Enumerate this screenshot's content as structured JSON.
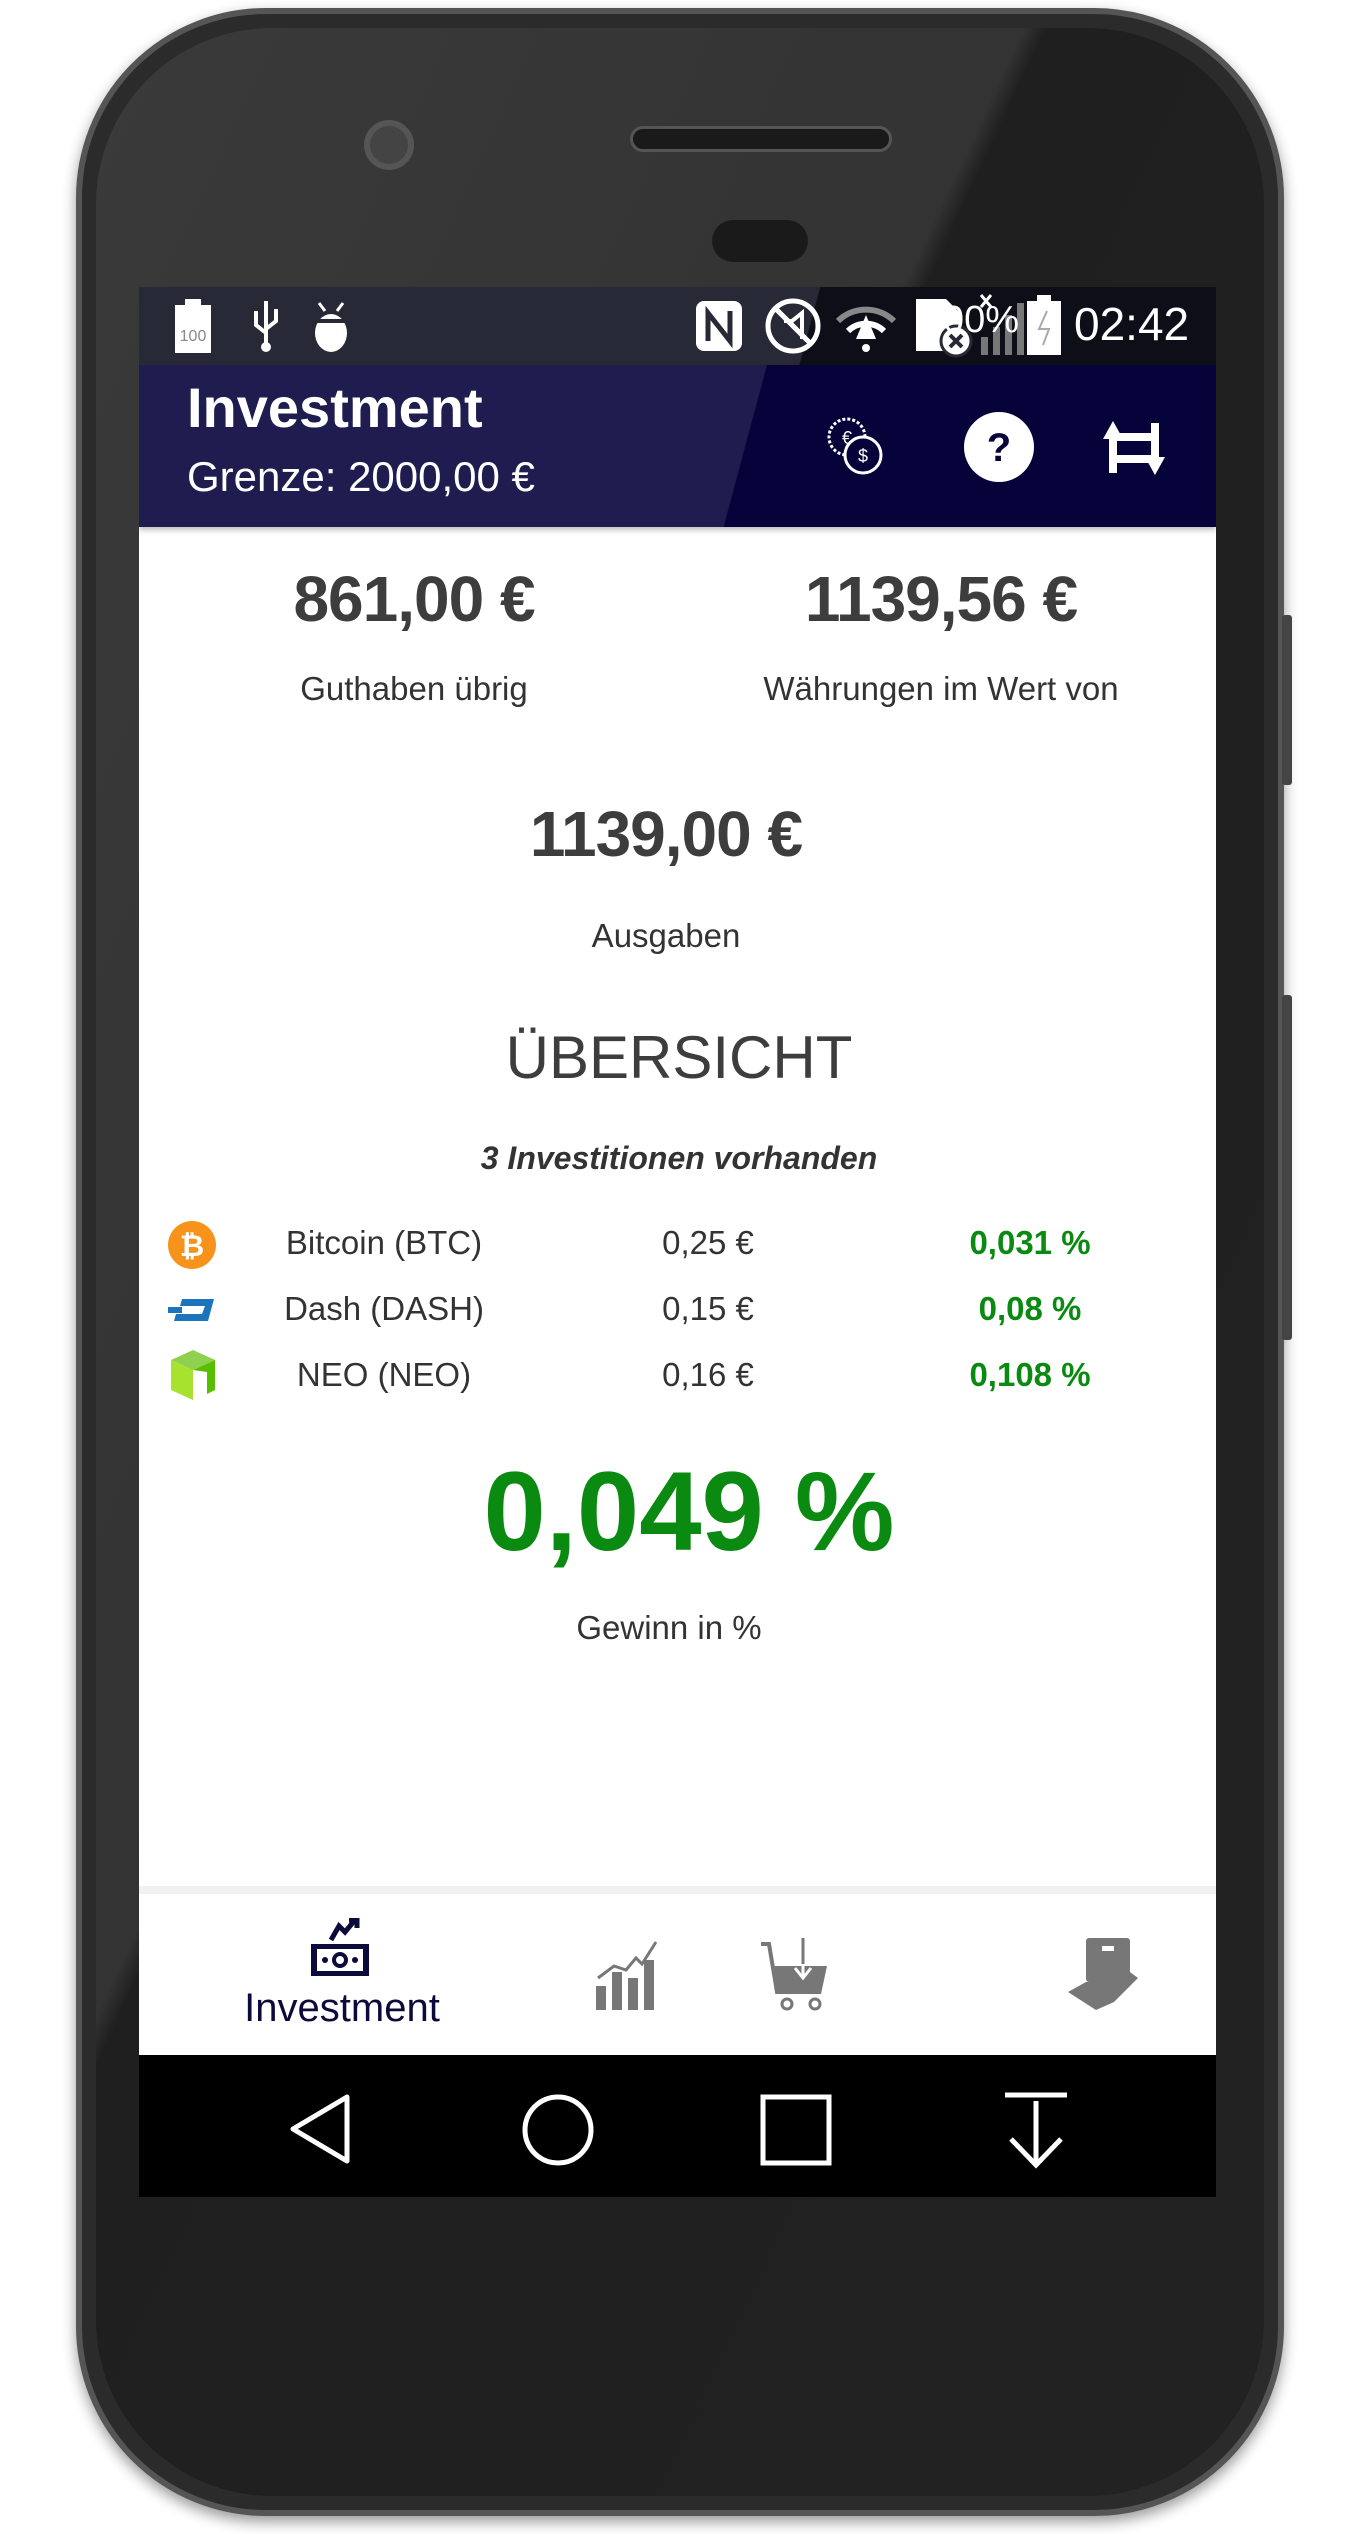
{
  "status_bar": {
    "battery_percent": "100%",
    "time": "02:42",
    "icons": [
      "battery-100-icon",
      "usb-icon",
      "bug-icon",
      "nfc-icon",
      "mute-icon",
      "wifi-icon",
      "sim-off-icon",
      "signal-icon",
      "battery-charging-icon"
    ]
  },
  "app_bar": {
    "title": "Investment",
    "subtitle": "Grenze: 2000,00 €",
    "actions": [
      "currency-exchange-icon",
      "help-icon",
      "refresh-icon"
    ]
  },
  "summary": {
    "remaining_value": "861,00 €",
    "remaining_label": "Guthaben übrig",
    "worth_value": "1139,56 €",
    "worth_label": "Währungen im Wert von",
    "spent_value": "1139,00 €",
    "spent_label": "Ausgaben"
  },
  "overview": {
    "title": "ÜBERSICHT",
    "count_text": "3 Investitionen vorhanden",
    "items": [
      {
        "name": "Bitcoin (BTC)",
        "value": "0,25 €",
        "percent": "0,031 %",
        "icon": "bitcoin-icon",
        "color": "#f7931a"
      },
      {
        "name": "Dash (DASH)",
        "value": "0,15 €",
        "percent": "0,08 %",
        "icon": "dash-icon",
        "color": "#1c75bc"
      },
      {
        "name": "NEO (NEO)",
        "value": "0,16 €",
        "percent": "0,108 %",
        "icon": "neo-icon",
        "color": "#58bf00"
      }
    ],
    "total_percent": "0,049 %",
    "total_label": "Gewinn in %"
  },
  "bottom_nav": {
    "active_label": "Investment",
    "items": [
      "investment-icon",
      "statistics-icon",
      "buy-icon",
      "sell-icon",
      "settings-icon"
    ]
  },
  "colors": {
    "appbar": "#05033a",
    "positive": "#0b8a12",
    "active_nav": "#0b0a3a",
    "inactive_nav": "#777777"
  }
}
